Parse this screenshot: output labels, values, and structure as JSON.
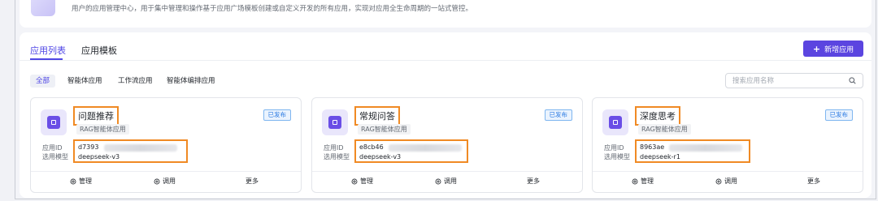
{
  "header": {
    "description": "用户的应用管理中心，用于集中管理和操作基于应用广场模板创建或自定义开发的所有应用，实现对应用全生命周期的一站式管控。"
  },
  "tabs": [
    {
      "label": "应用列表",
      "active": true
    },
    {
      "label": "应用模板",
      "active": false
    }
  ],
  "toolbar": {
    "new_app_label": "新增应用"
  },
  "filters": [
    {
      "label": "全部",
      "active": true
    },
    {
      "label": "智能体应用",
      "active": false
    },
    {
      "label": "工作流应用",
      "active": false
    },
    {
      "label": "智能体编排应用",
      "active": false
    }
  ],
  "search": {
    "placeholder": "搜索应用名称",
    "value": ""
  },
  "labels": {
    "app_id": "应用ID",
    "model": "选用模型"
  },
  "cards": [
    {
      "name": "问题推荐",
      "type": "RAG智能体应用",
      "status": "已发布",
      "id_prefix": "d7393",
      "model": "deepseek-v3",
      "actions": [
        "管理",
        "调用",
        "更多"
      ]
    },
    {
      "name": "常规问答",
      "type": "RAG智能体应用",
      "status": "已发布",
      "id_prefix": "e8cb46",
      "model": "deepseek-v3",
      "actions": [
        "管理",
        "调用",
        "更多"
      ]
    },
    {
      "name": "深度思考",
      "type": "RAG智能体应用",
      "status": "已发布",
      "id_prefix": "8963ae",
      "model": "deepseek-r1",
      "actions": [
        "管理",
        "调用",
        "更多"
      ]
    }
  ],
  "colors": {
    "accent": "#5b45e0",
    "highlight": "#f08a24",
    "status_blue": "#2a7ae2"
  }
}
